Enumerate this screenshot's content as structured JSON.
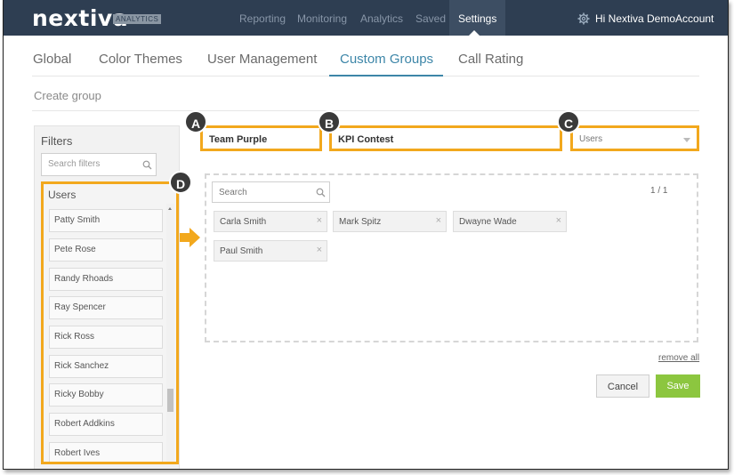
{
  "header": {
    "logo": "nextiva",
    "logo_badge": "ANALYTICS",
    "nav": [
      "Reporting",
      "Monitoring",
      "Analytics",
      "Saved",
      "Settings"
    ],
    "account": "Hi Nextiva DemoAccount"
  },
  "tabs": [
    "Global",
    "Color Themes",
    "User Management",
    "Custom Groups",
    "Call Rating"
  ],
  "active_tab": "Custom Groups",
  "page_title": "Create group",
  "fields": {
    "group_name": "Team Purple",
    "group_description": "KPI Contest",
    "group_type": "Users"
  },
  "markers": [
    "A",
    "B",
    "C",
    "D"
  ],
  "filters": {
    "title": "Filters",
    "search_placeholder": "Search filters",
    "users_heading": "Users",
    "users": [
      "Patty Smith",
      "Pete Rose",
      "Randy Rhoads",
      "Ray Spencer",
      "Rick Ross",
      "Rick Sanchez",
      "Ricky Bobby",
      "Robert Addkins",
      "Robert Ives"
    ]
  },
  "members": {
    "search_placeholder": "Search",
    "pager": "1 / 1",
    "selected": [
      "Carla Smith",
      "Mark Spitz",
      "Dwayne Wade",
      "Paul Smith"
    ]
  },
  "actions": {
    "remove_all": "remove all",
    "cancel": "Cancel",
    "save": "Save"
  },
  "colors": {
    "header_bg": "#2e3e52",
    "highlight": "#f2a81d",
    "accent": "#3d86a8",
    "save": "#8cc63f"
  }
}
